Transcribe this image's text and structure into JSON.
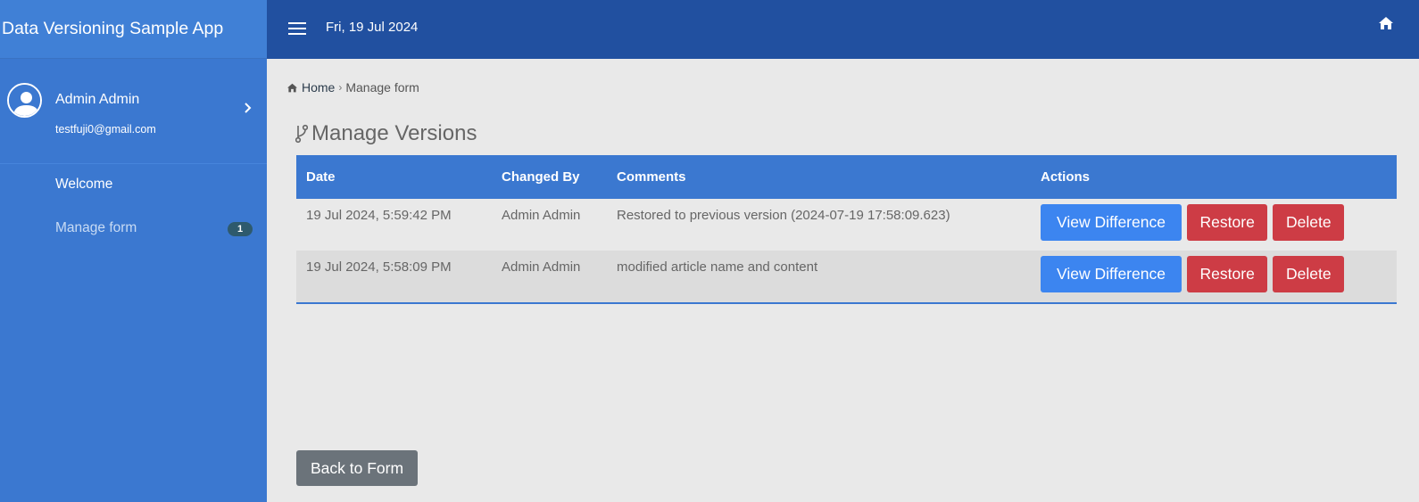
{
  "app": {
    "title": "Data Versioning Sample App"
  },
  "user": {
    "name": "Admin Admin",
    "email": "testfuji0@gmail.com"
  },
  "sidebar": {
    "items": [
      {
        "label": "Welcome"
      },
      {
        "label": "Manage form",
        "badge": "1"
      }
    ]
  },
  "topbar": {
    "date": "Fri, 19 Jul 2024"
  },
  "breadcrumb": {
    "home": "Home",
    "current": "Manage form"
  },
  "page": {
    "title": "Manage Versions"
  },
  "table": {
    "headers": [
      "Date",
      "Changed By",
      "Comments",
      "Actions"
    ],
    "rows": [
      {
        "date": "19 Jul 2024, 5:59:42 PM",
        "changed_by": "Admin Admin",
        "comments": "Restored to previous version (2024-07-19 17:58:09.623)"
      },
      {
        "date": "19 Jul 2024, 5:58:09 PM",
        "changed_by": "Admin Admin",
        "comments": "modified article name and content"
      }
    ],
    "actions": {
      "view": "View Difference",
      "restore": "Restore",
      "delete": "Delete"
    }
  },
  "footer": {
    "back_label": "Back to Form"
  },
  "colors": {
    "sidebar": "#3b78d0",
    "topbar": "#2150a0",
    "primary": "#3c85f0",
    "danger": "#cd3c45",
    "secondary": "#6b737a"
  }
}
